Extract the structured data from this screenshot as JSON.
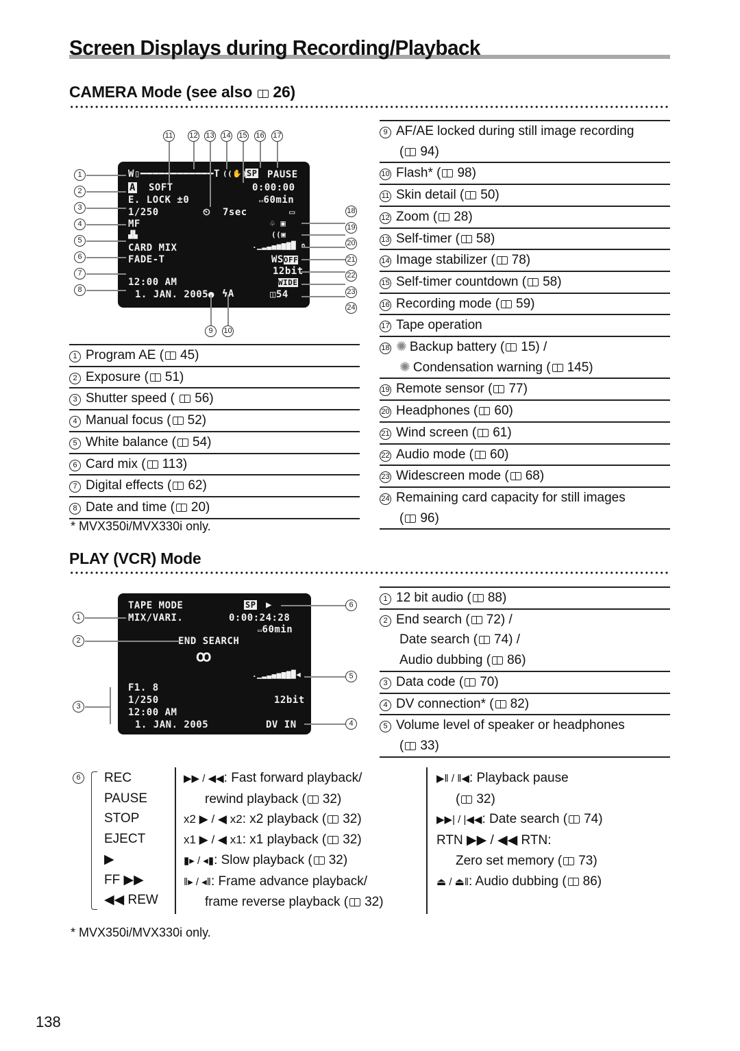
{
  "page": {
    "title": "Screen Displays during Recording/Playback",
    "page_number": "138"
  },
  "camera": {
    "heading": "CAMERA Mode (see also",
    "heading_ref": "26)",
    "screen": {
      "zoom_w": "W",
      "zoom_t": "T",
      "program_ae": "A",
      "skin_detail": "SOFT",
      "exposure": "E. LOCK ±0",
      "shutter": "1/250",
      "focus": "MF",
      "card_mix": "CARD MIX",
      "effect": "FADE-T",
      "time": "12:00 AM",
      "date": "1. JAN. 2005",
      "self_timer_icon": "self-timer",
      "countdown": "7sec",
      "rec_mode": "SP",
      "tape_op": "PAUSE",
      "timecode": "0:00:00",
      "tape_remaining": "60min",
      "wind": "WS",
      "wind_state": "OFF",
      "audio": "12bit",
      "wide": "WIDE",
      "card_capacity": "54",
      "flash": "ϟA"
    },
    "callouts_top": [
      "11",
      "12",
      "13",
      "14",
      "15",
      "16",
      "17"
    ],
    "callouts_left": [
      "1",
      "2",
      "3",
      "4",
      "5",
      "6",
      "7",
      "8"
    ],
    "callouts_right": [
      "18",
      "19",
      "20",
      "21",
      "22",
      "23",
      "24"
    ],
    "callouts_bottom": [
      "9",
      "10"
    ],
    "left_items": [
      {
        "num": "1",
        "text": "Program AE (",
        "ref": "45)"
      },
      {
        "num": "2",
        "text": "Exposure (",
        "ref": "51)"
      },
      {
        "num": "3",
        "text": "Shutter speed ( ",
        "ref": "56)"
      },
      {
        "num": "4",
        "text": "Manual focus (",
        "ref": "52)"
      },
      {
        "num": "5",
        "text": "White balance (",
        "ref": "54)"
      },
      {
        "num": "6",
        "text": "Card mix (",
        "ref": "113)"
      },
      {
        "num": "7",
        "text": "Digital effects (",
        "ref": "62)"
      },
      {
        "num": "8",
        "text": "Date and time (",
        "ref": "20)"
      }
    ],
    "right_items": [
      {
        "num": "9",
        "text": "AF/AE locked during still image recording",
        "line2": "(",
        "ref": "94)"
      },
      {
        "num": "10",
        "text": "Flash* (",
        "ref": "98)"
      },
      {
        "num": "11",
        "text": "Skin detail (",
        "ref": "50)"
      },
      {
        "num": "12",
        "text": "Zoom (",
        "ref": "28)"
      },
      {
        "num": "13",
        "text": "Self-timer (",
        "ref": "58)"
      },
      {
        "num": "14",
        "text": "Image stabilizer (",
        "ref": "78)"
      },
      {
        "num": "15",
        "text": "Self-timer countdown (",
        "ref": "58)"
      },
      {
        "num": "16",
        "text": "Recording mode (",
        "ref": "59)"
      },
      {
        "num": "17",
        "text": "Tape operation"
      },
      {
        "num": "18",
        "text": "Backup battery (",
        "ref": "15) /",
        "line2": "Condensation warning (",
        "ref2": "145)"
      },
      {
        "num": "19",
        "text": "Remote sensor (",
        "ref": "77)"
      },
      {
        "num": "20",
        "text": "Headphones (",
        "ref": "60)"
      },
      {
        "num": "21",
        "text": "Wind screen (",
        "ref": "61)"
      },
      {
        "num": "22",
        "text": "Audio mode (",
        "ref": "60)"
      },
      {
        "num": "23",
        "text": "Widescreen mode (",
        "ref": "68)"
      },
      {
        "num": "24",
        "text": "Remaining card capacity for still images",
        "line2": "(",
        "ref": "96)"
      }
    ],
    "footnote": "* MVX350i/MVX330i only."
  },
  "play": {
    "heading": "PLAY (VCR) Mode",
    "screen": {
      "tape_mode": "TAPE MODE",
      "audio_mix": "MIX/VARI.",
      "rec_mode": "SP",
      "play_icon": "▶",
      "timecode": "0:00:24:28",
      "tape_remaining": "60min",
      "search": "END SEARCH",
      "aperture": "F1. 8",
      "shutter": "1/250",
      "time": "12:00 AM",
      "date": "1. JAN. 2005",
      "audio": "12bit",
      "dv": "DV IN"
    },
    "callouts_left": [
      "1",
      "2",
      "3"
    ],
    "callouts_right": [
      "6",
      "5",
      "4"
    ],
    "items": [
      {
        "num": "1",
        "text": "12 bit audio (",
        "ref": "88)"
      },
      {
        "num": "2",
        "text": "End search (",
        "ref": "72) /",
        "line2": "Date search (",
        "ref2": "74) /",
        "line3": "Audio dubbing (",
        "ref3": "86)"
      },
      {
        "num": "3",
        "text": "Data code (",
        "ref": "70)"
      },
      {
        "num": "4",
        "text": "DV connection* (",
        "ref": "82)"
      },
      {
        "num": "5",
        "text": "Volume level of speaker or headphones",
        "line2": "(",
        "ref2": "33)"
      }
    ],
    "tape_ops": {
      "callout": "6",
      "col1": [
        "REC",
        "PAUSE",
        "STOP",
        "EJECT",
        "▶",
        "FF ▶▶",
        "◀◀ REW"
      ],
      "col2": [
        {
          "sym": "▶▶ / ◀◀",
          "text": ": Fast forward playback/"
        },
        {
          "sym": "",
          "text": "rewind playback (",
          "ref": "32)"
        },
        {
          "sym": "x2 ▶ / ◀ x2",
          "text": ": x2 playback  (",
          "ref": "32)"
        },
        {
          "sym": "x1 ▶ / ◀ x1",
          "text": ": x1 playback (",
          "ref": "32)"
        },
        {
          "sym": "▮▸ / ◂▮",
          "text": ": Slow playback (",
          "ref": "32)"
        },
        {
          "sym": "‖▸ / ◂‖",
          "text": ": Frame advance playback/"
        },
        {
          "sym": "",
          "text": "frame reverse playback  (",
          "ref": "32)"
        }
      ],
      "col3": [
        {
          "sym": "▶‖ / ‖◀",
          "text": ": Playback pause"
        },
        {
          "sym": "",
          "text": "(",
          "ref": "32)"
        },
        {
          "sym": "▶▶| / |◀◀",
          "text": ": Date search (",
          "ref": "74)"
        },
        {
          "sym": "RTN ▶▶ / ◀◀ RTN",
          "text": ":"
        },
        {
          "sym": "",
          "text": "Zero set memory (",
          "ref": "73)"
        },
        {
          "sym": "⏏ / ⏏‖",
          "text": ": Audio dubbing (",
          "ref": "86)"
        }
      ]
    },
    "footnote": "* MVX350i/MVX330i only."
  }
}
